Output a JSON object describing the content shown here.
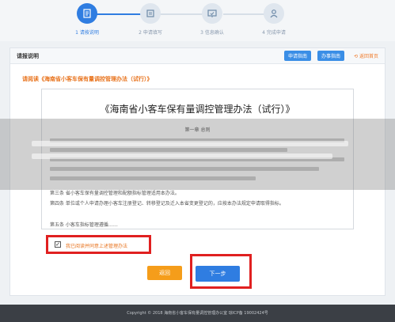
{
  "stepper": {
    "steps": [
      {
        "number": "1",
        "label": "请按说明",
        "state": "active"
      },
      {
        "number": "2",
        "label": "2 申请填写",
        "state": "pending"
      },
      {
        "number": "3",
        "label": "3 信息确认",
        "state": "pending"
      },
      {
        "number": "4",
        "label": "4 完成申请",
        "state": "pending"
      }
    ],
    "first_step_label": "1 请按说明"
  },
  "panel": {
    "title": "请报说明",
    "apply_guide_btn": "申请指南",
    "work_guide_btn": "办事指南",
    "back_link": "⟲ 返回首页"
  },
  "notice": "请阅读《海南省小客车保有量调控管理办法（试行）》",
  "document": {
    "title": "《海南省小客车保有量调控管理办法（试行）》",
    "chapter": "第一章  总则",
    "article3": "第三条  省小客车保有量调控管理和配额指标管理适用本办法。",
    "article4": "第四条  单位或个人申请办理小客车注册登记、转移登记及迁入本省变更登记的，应按本办法规定申请取得指标。",
    "article5": "第五条  小客车指标管理遵循……"
  },
  "agree": {
    "label": "我已阅读并同意上述管理办法",
    "checked_mark": "✓"
  },
  "buttons": {
    "return": "返回",
    "next": "下一步"
  },
  "footer": {
    "text": "Copyright © 2018  海南省小客车保有量调控管理办公室      琼ICP备 19002424号"
  },
  "colors": {
    "accent": "#2f7de1",
    "orange": "#f59d1a",
    "highlight_red": "#e02020",
    "footer_bg": "#3b3f45"
  }
}
